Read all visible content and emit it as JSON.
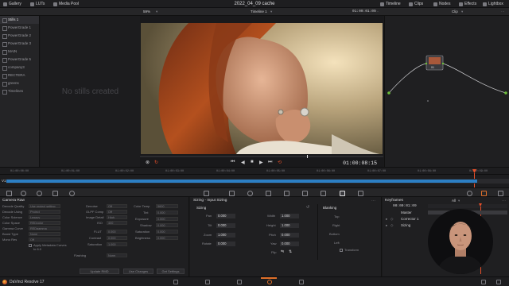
{
  "topbar": {
    "project_title": "2022_04_09 cache",
    "left_tabs": [
      {
        "label": "Gallery",
        "icon": "gallery-icon"
      },
      {
        "label": "LUTs",
        "icon": "luts-icon"
      },
      {
        "label": "Media Pool",
        "icon": "media-pool-icon"
      }
    ],
    "right_tabs": [
      {
        "label": "Timeline",
        "icon": "timeline-icon"
      },
      {
        "label": "Clips",
        "icon": "clips-icon"
      },
      {
        "label": "Nodes",
        "icon": "nodes-icon"
      },
      {
        "label": "Effects",
        "icon": "effects-icon"
      },
      {
        "label": "Lightbox",
        "icon": "lightbox-icon"
      }
    ]
  },
  "viewer_bar": {
    "zoom": "59%",
    "timeline_name": "Timeline 1",
    "timecode": "01:00:01:09",
    "node_mode": "Clip"
  },
  "gallery": {
    "albums": [
      "Stills 1",
      "PowerGrade 1",
      "PowerGrade 2",
      "PowerGrade 3",
      "MAIN",
      "PowerGrade 5",
      "company3",
      "RECTERA",
      "greens",
      "Timelines"
    ],
    "selected_index": 0,
    "empty_text": "No stills created"
  },
  "viewer": {
    "timecode": "01:00:08:15"
  },
  "nodes": {
    "node_label": "01"
  },
  "timeline": {
    "track_label": "V1",
    "ruler_ticks": [
      "01:00:00:00",
      "01:00:01:00",
      "01:00:02:00",
      "01:00:03:00",
      "01:00:04:00",
      "01:00:05:00",
      "01:00:06:00",
      "01:00:07:00",
      "01:00:08:00",
      "01:00:09:00",
      "01:00:10:00"
    ]
  },
  "camera_raw": {
    "title": "Camera Raw",
    "fields": [
      {
        "label": "Decode Quality",
        "value": "Use project setting"
      },
      {
        "label": "Decode Using",
        "value": "Project"
      },
      {
        "label": "Color Science",
        "value": "Legacy"
      },
      {
        "label": "Color Space",
        "value": "REDcolor"
      },
      {
        "label": "Gamma Curve",
        "value": "REDgamma"
      },
      {
        "label": "Boost Type",
        "value": "None"
      },
      {
        "label": "Mono Res",
        "value": "Off"
      }
    ],
    "checkbox_label": "Apply Metadata Curves",
    "checkbox_sub": "to 6.0",
    "mid_fields": [
      {
        "label": "Denoise",
        "value": "Off"
      },
      {
        "label": "OLPF Comp",
        "value": "Off"
      },
      {
        "label": "Image Detail",
        "value": "High"
      },
      {
        "label": "ISO",
        "value": "400"
      },
      {
        "label": "FLUT",
        "value": "0.000"
      },
      {
        "label": "Contrast",
        "value": "0.000"
      },
      {
        "label": "Saturation",
        "value": "1.000"
      },
      {
        "label": "Flashing",
        "value": "at Adjust"
      }
    ],
    "right_fields": [
      {
        "label": "Color Temp",
        "value": "5600"
      },
      {
        "label": "Tint",
        "value": "0.000"
      },
      {
        "label": "Exposure",
        "value": "0.000"
      },
      {
        "label": "Shadow",
        "value": "0.000"
      },
      {
        "label": "Saturation",
        "value": "0.000"
      },
      {
        "label": "Brightness",
        "value": "0.000"
      }
    ],
    "buttons": [
      "Update RMD",
      "Use Changes",
      "Get Settings"
    ]
  },
  "sizing": {
    "title": "Sizing - Input Sizing",
    "section": "Sizing",
    "left": [
      {
        "label": "Pan",
        "value": "0.000"
      },
      {
        "label": "Tilt",
        "value": "0.000"
      },
      {
        "label": "Zoom",
        "value": "1.000"
      },
      {
        "label": "Rotate",
        "value": "0.000"
      }
    ],
    "right": [
      {
        "label": "Width",
        "value": "1.000"
      },
      {
        "label": "Height",
        "value": "1.000"
      },
      {
        "label": "Pitch",
        "value": "0.000"
      },
      {
        "label": "Yaw",
        "value": "0.000"
      }
    ],
    "flip_label": "Flip"
  },
  "blanking": {
    "title": "Blanking",
    "fields": [
      "Top",
      "Right",
      "Bottom",
      "Left"
    ],
    "toggle_label": "Transform"
  },
  "keyframes": {
    "title": "Keyframes",
    "filter": "All",
    "timecode": "00:00:01:09",
    "rows": [
      "Master",
      "Corrector 1",
      "Sizing"
    ]
  },
  "status": {
    "app_name": "DaVinci Resolve 17",
    "pages": [
      "media-icon",
      "cut-icon",
      "edit-icon",
      "fusion-icon",
      "color-icon",
      "fairlight-icon",
      "deliver-icon"
    ],
    "active_page": 3
  },
  "colors": {
    "accent": "#e0702a",
    "track_blue": "#2c7fc4",
    "playhead": "#e8502a",
    "node_green": "#6cbe3a"
  }
}
